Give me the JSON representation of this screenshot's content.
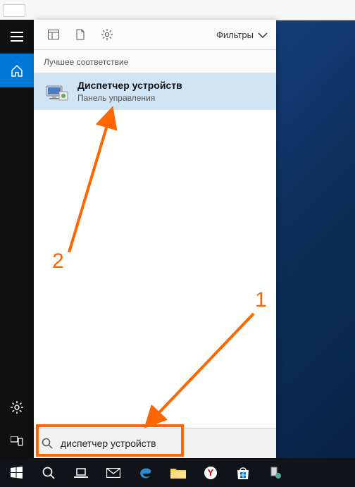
{
  "colors": {
    "accent": "#0078d7",
    "annotation": "#ff6600",
    "highlight": "#cfe4f5"
  },
  "header": {
    "filters_label": "Фильтры"
  },
  "section": {
    "best_match_label": "Лучшее соответствие"
  },
  "best_match": {
    "title": "Диспетчер устройств",
    "subtitle": "Панель управления"
  },
  "search": {
    "value": "диспетчер устройств",
    "placeholder": ""
  },
  "annotations": {
    "label1": "1",
    "label2": "2"
  },
  "rail": {
    "items": [
      {
        "name": "hamburger",
        "icon": "hamburger-icon"
      },
      {
        "name": "home",
        "icon": "home-icon",
        "active": true
      }
    ],
    "bottom_items": [
      {
        "name": "settings",
        "icon": "gear-icon"
      },
      {
        "name": "devices",
        "icon": "devices-icon"
      }
    ]
  },
  "taskbar": {
    "items": [
      {
        "name": "start",
        "icon": "windows-icon"
      },
      {
        "name": "search",
        "icon": "search-circle-icon"
      },
      {
        "name": "taskview",
        "icon": "taskview-icon"
      },
      {
        "name": "mail",
        "icon": "mail-icon"
      },
      {
        "name": "edge",
        "icon": "edge-icon"
      },
      {
        "name": "explorer",
        "icon": "folder-icon"
      },
      {
        "name": "yandex",
        "icon": "yandex-icon"
      },
      {
        "name": "store",
        "icon": "store-icon"
      },
      {
        "name": "app",
        "icon": "app-icon"
      }
    ]
  }
}
